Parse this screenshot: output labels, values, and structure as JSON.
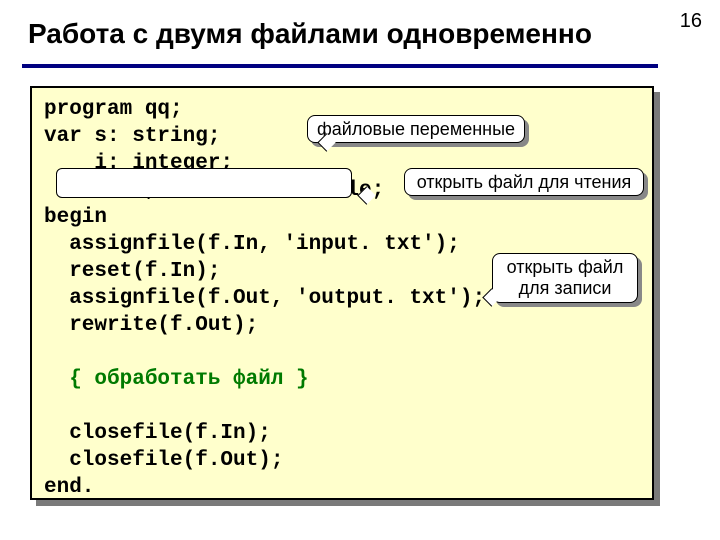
{
  "page_number": "16",
  "title": "Работа с двумя файлами одновременно",
  "code": {
    "l1": "program qq;",
    "l2": "var s: string;",
    "l3": "    i: integer;",
    "l4": "    f.In, f.Out: text.File;",
    "l5": "begin",
    "l6": "  assignfile(f.In, 'input. txt');",
    "l7": "  reset(f.In);",
    "l8": "  assignfile(f.Out, 'output. txt');",
    "l9": "  rewrite(f.Out);",
    "blank": " ",
    "l10a": "  ",
    "l10b": "{ обработать файл }",
    "l11": "  closefile(f.In);",
    "l12": "  closefile(f.Out);",
    "l13": "end."
  },
  "callouts": {
    "c1": "файловые переменные",
    "c2": "открыть файл для чтения",
    "c3": "открыть файл для записи"
  }
}
